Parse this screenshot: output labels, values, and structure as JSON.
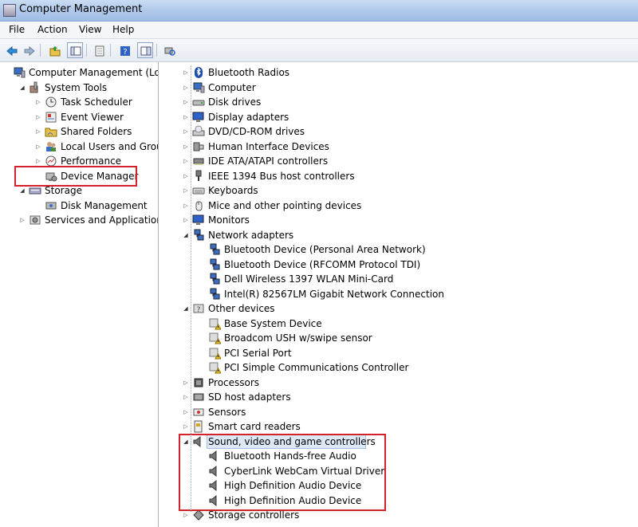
{
  "window": {
    "title": "Computer Management"
  },
  "menu": [
    "File",
    "Action",
    "View",
    "Help"
  ],
  "toolbar": [
    "back-arrow-icon",
    "forward-arrow-icon",
    "up-folder-icon",
    "show-hide-tree-icon",
    "properties-icon",
    "help-icon",
    "console-tree-icon",
    "scan-hardware-icon"
  ],
  "left_tree": [
    {
      "label": "Computer Management (Local",
      "icon": "computer-management-icon",
      "level": 0,
      "expander": "none"
    },
    {
      "label": "System Tools",
      "icon": "system-tools-icon",
      "level": 1,
      "expander": "expanded"
    },
    {
      "label": "Task Scheduler",
      "icon": "clock-icon",
      "level": 2,
      "expander": "collapsed"
    },
    {
      "label": "Event Viewer",
      "icon": "event-viewer-icon",
      "level": 2,
      "expander": "collapsed"
    },
    {
      "label": "Shared Folders",
      "icon": "shared-folder-icon",
      "level": 2,
      "expander": "collapsed"
    },
    {
      "label": "Local Users and Groups",
      "icon": "users-icon",
      "level": 2,
      "expander": "collapsed"
    },
    {
      "label": "Performance",
      "icon": "performance-icon",
      "level": 2,
      "expander": "collapsed"
    },
    {
      "label": "Device Manager",
      "icon": "device-manager-icon",
      "level": 2,
      "expander": "none",
      "selected": true
    },
    {
      "label": "Storage",
      "icon": "storage-icon",
      "level": 1,
      "expander": "expanded"
    },
    {
      "label": "Disk Management",
      "icon": "disk-management-icon",
      "level": 2,
      "expander": "none"
    },
    {
      "label": "Services and Applications",
      "icon": "services-icon",
      "level": 1,
      "expander": "collapsed"
    }
  ],
  "device_tree": [
    {
      "label": "Bluetooth Radios",
      "icon": "bluetooth-icon",
      "level": 0,
      "expander": "collapsed"
    },
    {
      "label": "Computer",
      "icon": "computer-icon",
      "level": 0,
      "expander": "collapsed"
    },
    {
      "label": "Disk drives",
      "icon": "disk-drive-icon",
      "level": 0,
      "expander": "collapsed"
    },
    {
      "label": "Display adapters",
      "icon": "display-adapter-icon",
      "level": 0,
      "expander": "collapsed"
    },
    {
      "label": "DVD/CD-ROM drives",
      "icon": "dvd-drive-icon",
      "level": 0,
      "expander": "collapsed"
    },
    {
      "label": "Human Interface Devices",
      "icon": "hid-icon",
      "level": 0,
      "expander": "collapsed"
    },
    {
      "label": "IDE ATA/ATAPI controllers",
      "icon": "ide-controller-icon",
      "level": 0,
      "expander": "collapsed"
    },
    {
      "label": "IEEE 1394 Bus host controllers",
      "icon": "firewire-icon",
      "level": 0,
      "expander": "collapsed"
    },
    {
      "label": "Keyboards",
      "icon": "keyboard-icon",
      "level": 0,
      "expander": "collapsed"
    },
    {
      "label": "Mice and other pointing devices",
      "icon": "mouse-icon",
      "level": 0,
      "expander": "collapsed"
    },
    {
      "label": "Monitors",
      "icon": "monitor-icon",
      "level": 0,
      "expander": "collapsed"
    },
    {
      "label": "Network adapters",
      "icon": "network-adapter-icon",
      "level": 0,
      "expander": "expanded"
    },
    {
      "label": "Bluetooth Device (Personal Area Network)",
      "icon": "network-device-icon",
      "level": 1,
      "expander": "none"
    },
    {
      "label": "Bluetooth Device (RFCOMM Protocol TDI)",
      "icon": "network-device-icon",
      "level": 1,
      "expander": "none"
    },
    {
      "label": "Dell Wireless 1397 WLAN Mini-Card",
      "icon": "network-device-icon",
      "level": 1,
      "expander": "none"
    },
    {
      "label": "Intel(R) 82567LM Gigabit Network Connection",
      "icon": "network-device-icon",
      "level": 1,
      "expander": "none"
    },
    {
      "label": "Other devices",
      "icon": "other-devices-icon",
      "level": 0,
      "expander": "expanded"
    },
    {
      "label": "Base System Device",
      "icon": "unknown-device-warning-icon",
      "level": 1,
      "expander": "none"
    },
    {
      "label": "Broadcom USH w/swipe sensor",
      "icon": "unknown-device-warning-icon",
      "level": 1,
      "expander": "none"
    },
    {
      "label": "PCI Serial Port",
      "icon": "unknown-device-warning-icon",
      "level": 1,
      "expander": "none"
    },
    {
      "label": "PCI Simple Communications Controller",
      "icon": "unknown-device-warning-icon",
      "level": 1,
      "expander": "none"
    },
    {
      "label": "Processors",
      "icon": "processor-icon",
      "level": 0,
      "expander": "collapsed"
    },
    {
      "label": "SD host adapters",
      "icon": "sd-host-icon",
      "level": 0,
      "expander": "collapsed"
    },
    {
      "label": "Sensors",
      "icon": "sensor-icon",
      "level": 0,
      "expander": "collapsed"
    },
    {
      "label": "Smart card readers",
      "icon": "smart-card-icon",
      "level": 0,
      "expander": "collapsed"
    },
    {
      "label": "Sound, video and game controllers",
      "icon": "speaker-icon",
      "level": 0,
      "expander": "expanded",
      "selected": true
    },
    {
      "label": "Bluetooth Hands-free Audio",
      "icon": "speaker-icon",
      "level": 1,
      "expander": "none"
    },
    {
      "label": "CyberLink WebCam Virtual Driver",
      "icon": "speaker-icon",
      "level": 1,
      "expander": "none"
    },
    {
      "label": "High Definition Audio Device",
      "icon": "speaker-icon",
      "level": 1,
      "expander": "none"
    },
    {
      "label": "High Definition Audio Device",
      "icon": "speaker-icon",
      "level": 1,
      "expander": "none"
    },
    {
      "label": "Storage controllers",
      "icon": "storage-controller-icon",
      "level": 0,
      "expander": "collapsed"
    }
  ],
  "colors": {
    "highlight_box": "#d2232a",
    "selection": "#dde8f7",
    "title_bar": "#aec8ea"
  }
}
